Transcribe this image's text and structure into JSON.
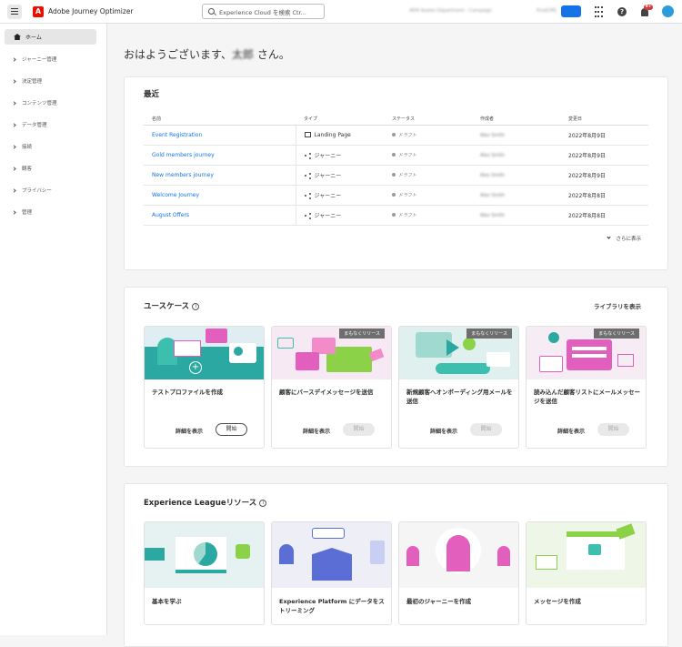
{
  "app": {
    "name": "Adobe Journey Optimizer",
    "logo_letter": "A",
    "brand_color": "#eb1000"
  },
  "search": {
    "placeholder": "Experience Cloud を検索 Ctr..."
  },
  "header": {
    "org_name": "AEM Assets Department - Campaign",
    "org_sub": "ProdCMS",
    "notification_count": "9+"
  },
  "sidebar": {
    "items": [
      {
        "label": "ホーム",
        "icon": "home-icon"
      },
      {
        "label": "ジャーニー管理"
      },
      {
        "label": "決定管理"
      },
      {
        "label": "コンテンツ管理"
      },
      {
        "label": "データ管理"
      },
      {
        "label": "接続"
      },
      {
        "label": "観客"
      },
      {
        "label": "プライバシー"
      },
      {
        "label": "管理"
      }
    ]
  },
  "greeting": {
    "prefix": "おはようございます、",
    "name": "太郎",
    "suffix": " さん。"
  },
  "recent": {
    "title": "最近",
    "columns": [
      "名前",
      "タイプ",
      "ステータス",
      "作成者",
      "変更日"
    ],
    "rows": [
      {
        "name": "Event Registration",
        "type": "Landing Page",
        "type_icon": "page-icon",
        "status": "ドラフト",
        "author": "Alex Smith",
        "date": "2022年8月9日"
      },
      {
        "name": "Gold members journey",
        "type": "ジャーニー",
        "type_icon": "journey-icon",
        "status": "ドラフト",
        "author": "Alex Smith",
        "date": "2022年8月9日"
      },
      {
        "name": "New members journey",
        "type": "ジャーニー",
        "type_icon": "journey-icon",
        "status": "ドラフト",
        "author": "Alex Smith",
        "date": "2022年8月9日"
      },
      {
        "name": "Welcome Journey",
        "type": "ジャーニー",
        "type_icon": "journey-icon",
        "status": "ドラフト",
        "author": "Alex Smith",
        "date": "2022年8月8日"
      },
      {
        "name": "August Offers",
        "type": "ジャーニー",
        "type_icon": "journey-icon",
        "status": "ドラフト",
        "author": "Alex Smith",
        "date": "2022年8月8日"
      }
    ],
    "more_label": "さらに表示"
  },
  "usecases": {
    "title": "ユースケース",
    "library_link": "ライブラリを表示",
    "soon_badge": "まもなくリリース",
    "details_label": "詳細を表示",
    "open_label": "開始",
    "tiles": [
      {
        "title": "テストプロファイルを作成",
        "soon": false,
        "enabled": true
      },
      {
        "title": "顧客にバースデイメッセージを送信",
        "soon": true,
        "enabled": false
      },
      {
        "title": "新規顧客へオンボーディング用メールを送信",
        "soon": true,
        "enabled": false
      },
      {
        "title": "読み込んだ顧客リストにメールメッセージを送信",
        "soon": true,
        "enabled": false
      }
    ]
  },
  "league": {
    "title": "Experience Leagueリソース",
    "tiles": [
      {
        "title": "基本を学ぶ"
      },
      {
        "title": "Experience Platform にデータをストリーミング"
      },
      {
        "title": "最初のジャーニーを作成"
      },
      {
        "title": "メッセージを作成"
      }
    ]
  },
  "colors": {
    "link": "#1473e6",
    "accent_teal": "#3cbfae",
    "accent_pink": "#e35fbd",
    "accent_green": "#8bd249"
  }
}
